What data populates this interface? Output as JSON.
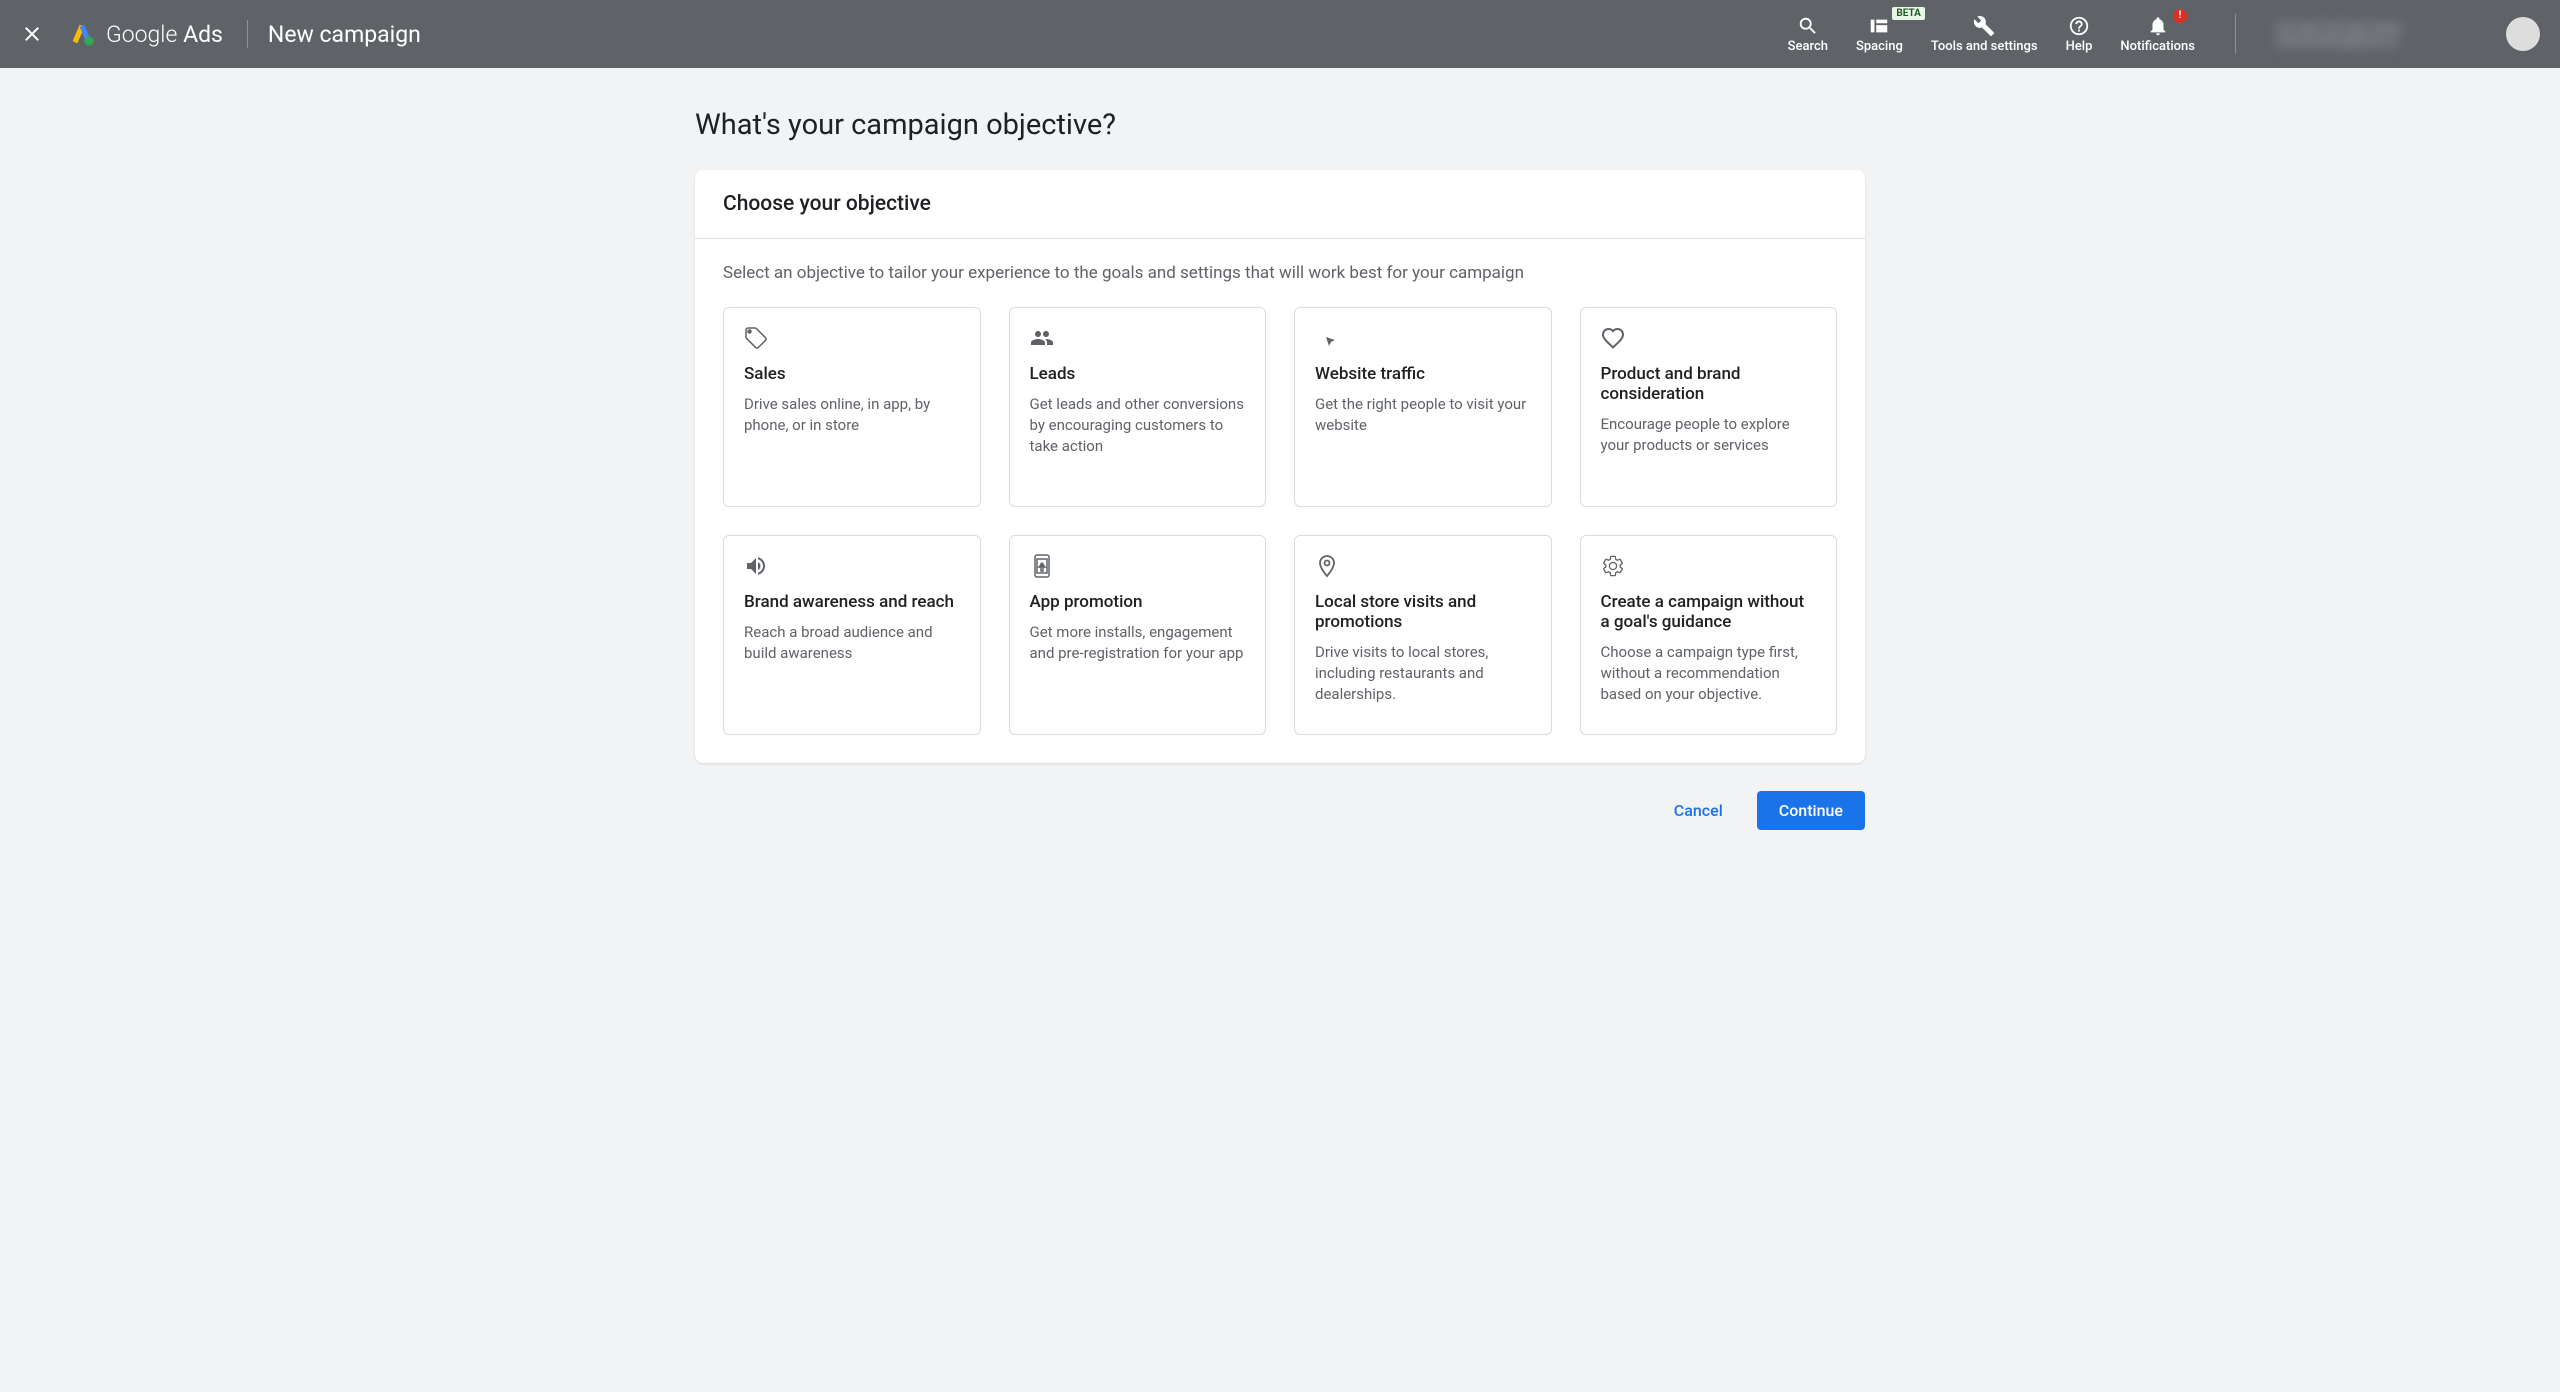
{
  "header": {
    "logo_text_1": "Google",
    "logo_text_2": " Ads",
    "page_title": "New campaign",
    "actions": {
      "search": "Search",
      "spacing": "Spacing",
      "spacing_badge": "BETA",
      "tools": "Tools and settings",
      "help": "Help",
      "notifications": "Notifications"
    }
  },
  "main": {
    "heading": "What's your campaign objective?",
    "card_title": "Choose your objective",
    "card_subtitle": "Select an objective to tailor your experience to the goals and settings that will work best for your campaign"
  },
  "objectives": [
    {
      "title": "Sales",
      "description": "Drive sales online, in app, by phone, or in store"
    },
    {
      "title": "Leads",
      "description": "Get leads and other conversions by encouraging customers to take action"
    },
    {
      "title": "Website traffic",
      "description": "Get the right people to visit your website"
    },
    {
      "title": "Product and brand consideration",
      "description": "Encourage people to explore your products or services"
    },
    {
      "title": "Brand awareness and reach",
      "description": "Reach a broad audience and build awareness"
    },
    {
      "title": "App promotion",
      "description": "Get more installs, engagement and pre-registration for your app"
    },
    {
      "title": "Local store visits and promotions",
      "description": "Drive visits to local stores, including restaurants and dealerships."
    },
    {
      "title": "Create a campaign without a goal's guidance",
      "description": "Choose a campaign type first, without a recommendation based on your objective."
    }
  ],
  "footer": {
    "cancel": "Cancel",
    "continue": "Continue"
  }
}
